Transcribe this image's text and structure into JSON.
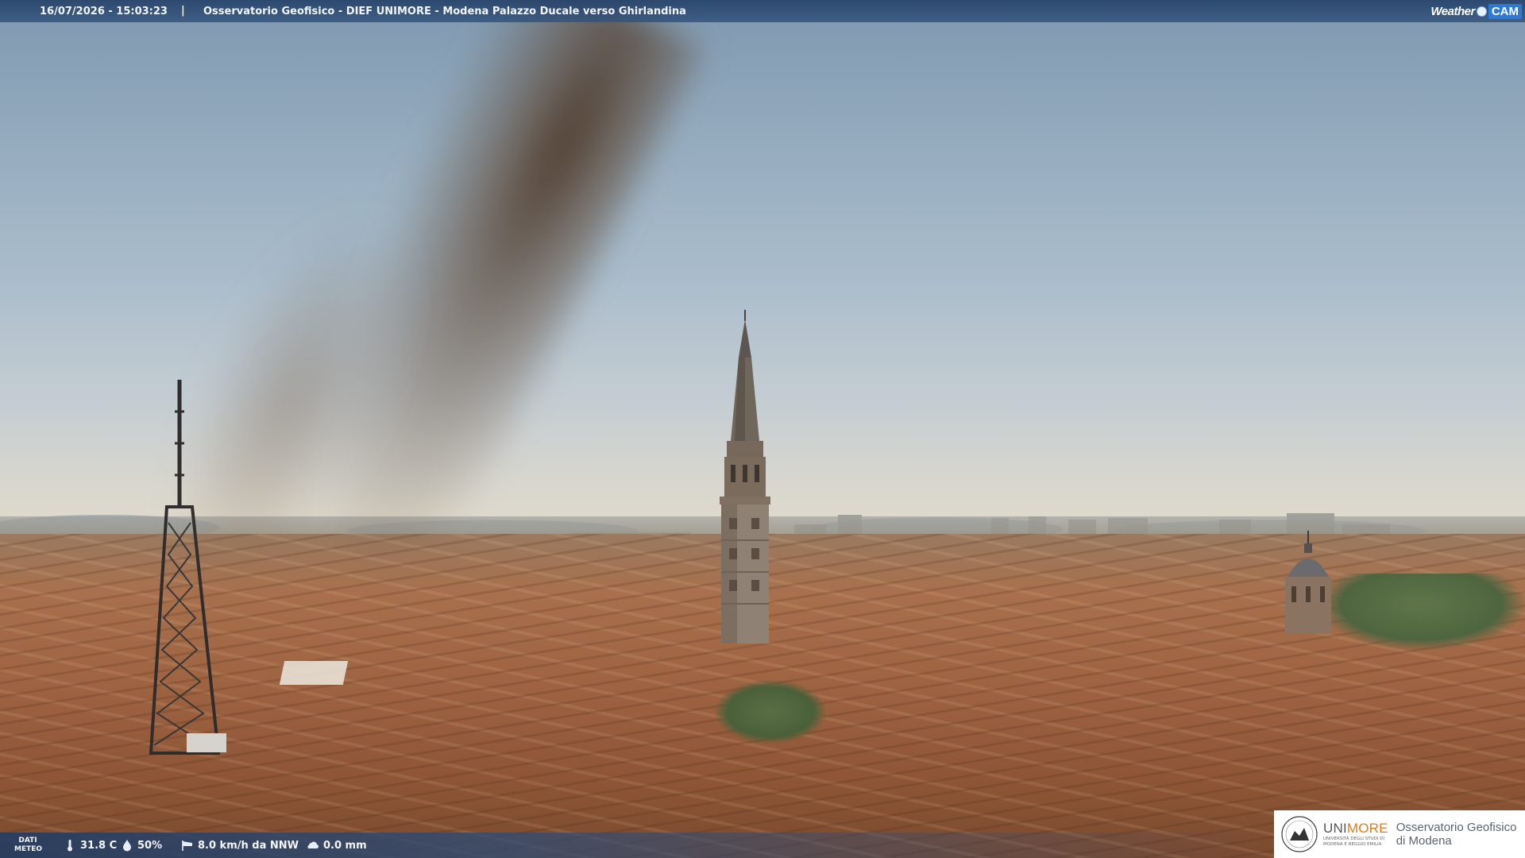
{
  "overlay": {
    "timestamp": "16/07/2026 - 15:03:23",
    "separator": "|",
    "title": "Osservatorio Geofisico - DIEF UNIMORE - Modena Palazzo Ducale verso Ghirlandina",
    "brand": {
      "weather": "Weather",
      "cam": "CAM"
    }
  },
  "meteo": {
    "label_line1": "DATI",
    "label_line2": "METEO",
    "temperature": "31.8 C",
    "humidity": "50%",
    "wind": "8.0 km/h da NNW",
    "rain": "0.0 mm",
    "icons": [
      "thermometer-icon",
      "humidity-drop-icon",
      "wind-sock-icon",
      "rain-cloud-icon"
    ]
  },
  "logo": {
    "uni_part1": "UNI",
    "uni_part2": "MORE",
    "uni_sub": "UNIVERSITÀ DEGLI STUDI DI MODENA E REGGIO EMILIA",
    "obs_line1": "Osservatorio Geofisico",
    "obs_line2": "di Modena"
  },
  "colors": {
    "bar": "#264269",
    "cam_accent": "#2d7ad6",
    "logo_orange": "#e07b1a"
  }
}
